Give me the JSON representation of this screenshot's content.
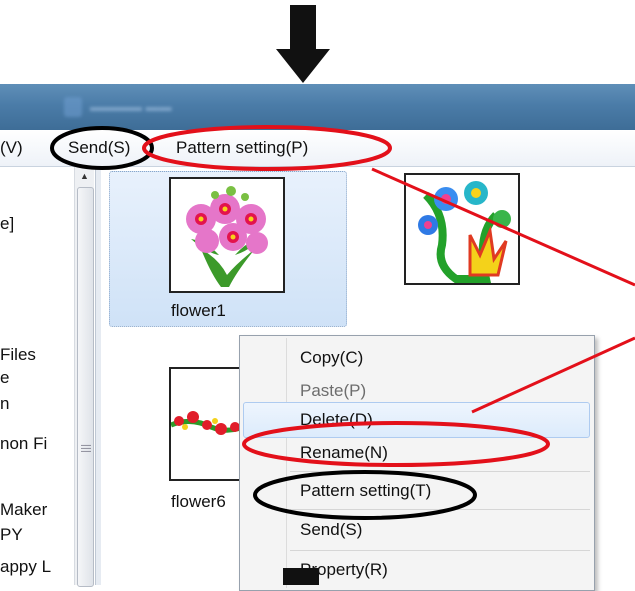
{
  "menubar": {
    "view_partial": "(V)",
    "send": "Send(S)",
    "pattern_setting": "Pattern setting(P)"
  },
  "tree": {
    "items": [
      "e]",
      "Files",
      "e",
      "n",
      "non Fi",
      "Maker",
      "PY",
      "appy L"
    ]
  },
  "files": {
    "items": [
      {
        "label": "flower1"
      },
      {
        "label": "flower6"
      }
    ]
  },
  "context_menu": {
    "items": [
      {
        "label": "Copy(C)"
      },
      {
        "label": "Paste(P)"
      },
      {
        "label": "Delete(D)"
      },
      {
        "label": "Rename(N)"
      },
      {
        "label": "Pattern setting(T)"
      },
      {
        "label": "Send(S)"
      },
      {
        "label": "Property(R)"
      }
    ]
  },
  "colors": {
    "highlight_red": "#e3101a",
    "highlight_black": "#000000",
    "titlebar": "#4b7ca8",
    "selection": "#cfe2f7"
  },
  "icons": [
    "down-arrow-icon",
    "scroll-up-icon",
    "scroll-grip-icon"
  ]
}
